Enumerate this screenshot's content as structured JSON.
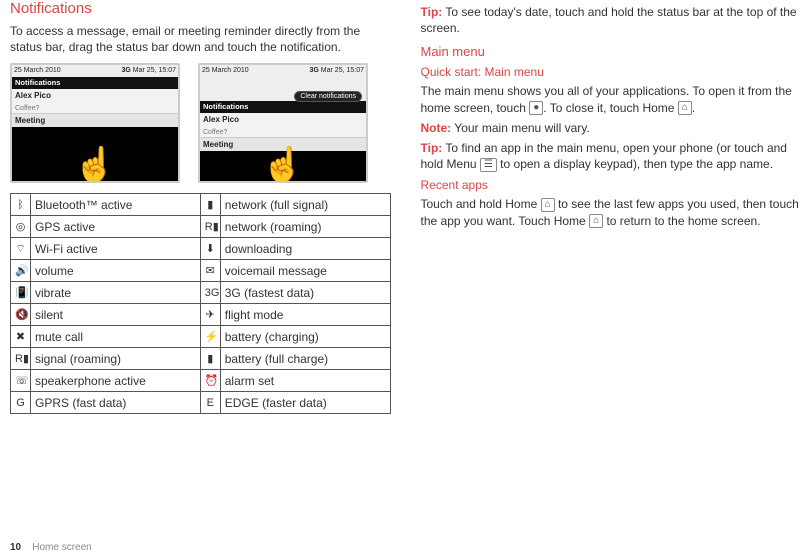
{
  "left": {
    "heading": "Notifications",
    "intro": "To access a message, email or meeting reminder directly from the status bar, drag the status bar down and touch the notification.",
    "phone1": {
      "status_left": "25 March 2010",
      "status_right": "Mar 25, 15:07",
      "net": "3G",
      "bar": "Notifications",
      "contact": "Alex Pico",
      "sub": "Coffee?",
      "row": "Meeting"
    },
    "phone2": {
      "status_left": "25 March 2010",
      "status_right": "Mar 25, 15:07",
      "net": "3G",
      "clear": "Clear notifications",
      "bar": "Notifications",
      "contact": "Alex Pico",
      "sub": "Coffee?",
      "row": "Meeting"
    },
    "table": {
      "rows": [
        {
          "i1": "ᛒ",
          "l1": "Bluetooth™ active",
          "i2": "▮",
          "l2": "network (full signal)"
        },
        {
          "i1": "◎",
          "l1": "GPS active",
          "i2": "R▮",
          "l2": "network (roaming)"
        },
        {
          "i1": "⌔",
          "l1": "Wi-Fi active",
          "i2": "⬇",
          "l2": "downloading"
        },
        {
          "i1": "🔊",
          "l1": "volume",
          "i2": "✉",
          "l2": "voicemail message"
        },
        {
          "i1": "📳",
          "l1": "vibrate",
          "i2": "3G",
          "l2": "3G (fastest data)"
        },
        {
          "i1": "🔇",
          "l1": "silent",
          "i2": "✈",
          "l2": "flight mode"
        },
        {
          "i1": "✖",
          "l1": "mute call",
          "i2": "⚡",
          "l2": "battery (charging)"
        },
        {
          "i1": "R▮",
          "l1": "signal (roaming)",
          "i2": "▮",
          "l2": "battery (full charge)"
        },
        {
          "i1": "☏",
          "l1": "speakerphone active",
          "i2": "⏰",
          "l2": "alarm set"
        },
        {
          "i1": "G",
          "l1": "GPRS (fast data)",
          "i2": "E",
          "l2": "EDGE (faster data)"
        }
      ]
    }
  },
  "right": {
    "tip1_label": "Tip:",
    "tip1": " To see today's date, touch and hold the status bar at the top of the screen.",
    "h_main": "Main menu",
    "h_quick": "Quick start: Main menu",
    "p1a": "The main menu shows you all of your applications. To open it from the home screen, touch ",
    "p1b": ". To close it, touch Home ",
    "p1c": ".",
    "note_label": "Note:",
    "note": " Your main menu will vary.",
    "tip2_label": "Tip:",
    "tip2a": " To find an app in the main menu, open your phone (or touch and hold Menu ",
    "tip2b": " to open a display keypad), then type the app name.",
    "h_recent": "Recent apps",
    "p2a": "Touch and hold Home ",
    "p2b": " to see the last few apps you used, then touch the app you want. Touch Home ",
    "p2c": " to return to the home screen."
  },
  "footer": {
    "pagenum": "10",
    "label": "Home screen"
  }
}
